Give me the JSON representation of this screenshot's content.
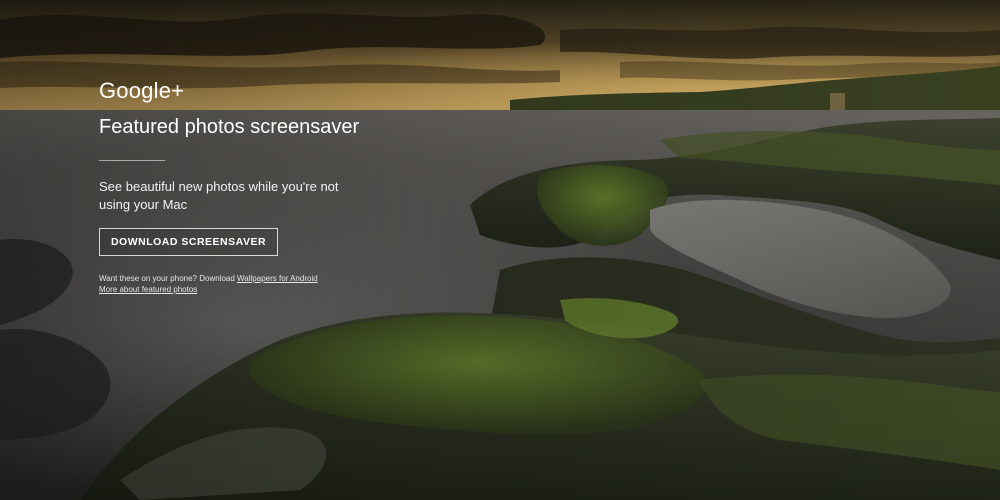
{
  "brand": {
    "logo_text": "Google+"
  },
  "hero": {
    "title": "Featured photos screensaver",
    "description": "See beautiful new photos while you're not using your Mac",
    "download_button_label": "DOWNLOAD SCREENSAVER"
  },
  "footnote": {
    "phone_prefix": "Want these on your phone? Download",
    "wallpapers_link": "Wallpapers for Android",
    "more_link": "More about featured photos"
  },
  "colors": {
    "text": "#ffffff",
    "moss": "#5f7a2b",
    "sky_glow": "#d3a54d"
  }
}
